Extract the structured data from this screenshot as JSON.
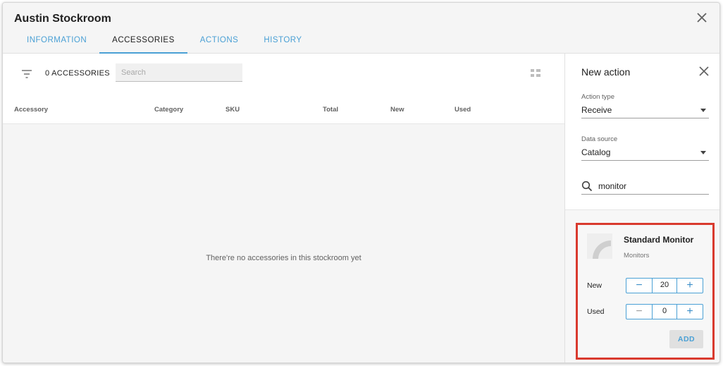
{
  "window": {
    "title": "Austin Stockroom"
  },
  "tabs": [
    {
      "label": "INFORMATION"
    },
    {
      "label": "ACCESSORIES"
    },
    {
      "label": "ACTIONS"
    },
    {
      "label": "HISTORY"
    }
  ],
  "toolbar": {
    "count_label": "0 ACCESSORIES",
    "search_placeholder": "Search"
  },
  "table": {
    "columns": [
      "Accessory",
      "Category",
      "SKU",
      "Total",
      "New",
      "Used"
    ]
  },
  "empty_message": "There're no accessories in this stockroom yet",
  "side_panel": {
    "title": "New action",
    "action_type": {
      "label": "Action type",
      "value": "Receive"
    },
    "data_source": {
      "label": "Data source",
      "value": "Catalog"
    },
    "search": {
      "value": "monitor"
    },
    "item": {
      "name": "Standard Monitor",
      "category": "Monitors",
      "new_label": "New",
      "new_value": "20",
      "used_label": "Used",
      "used_value": "0",
      "add_label": "ADD"
    }
  },
  "colors": {
    "accent": "#4aa0d5",
    "highlight": "#d93a2e"
  }
}
